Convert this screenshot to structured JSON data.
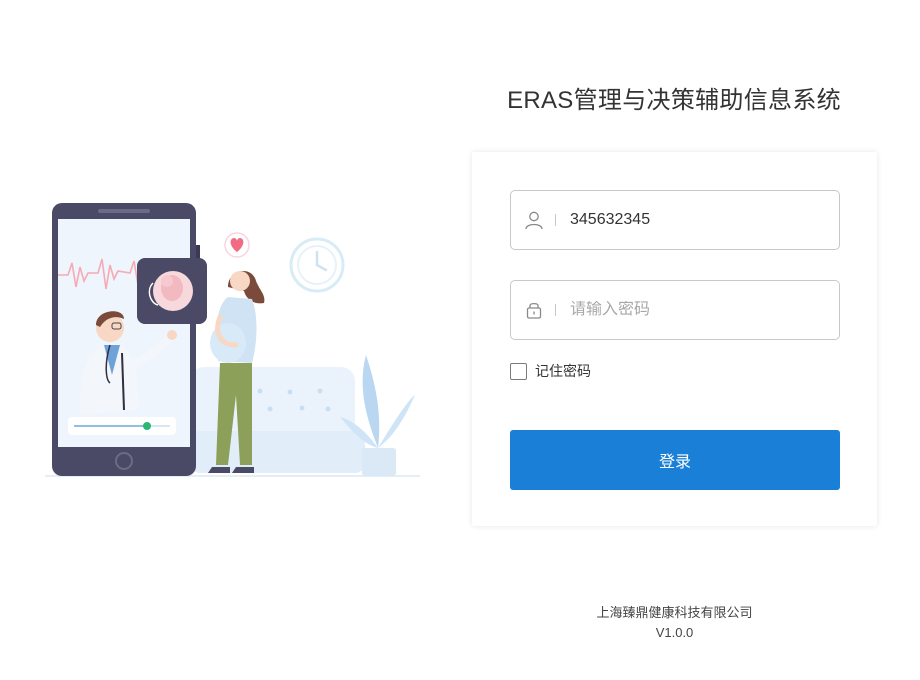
{
  "title": "ERAS管理与决策辅助信息系统",
  "login": {
    "username_value": "345632345",
    "password_placeholder": "请输入密码",
    "remember_label": "记住密码",
    "submit_label": "登录"
  },
  "footer": {
    "company": "上海臻鼎健康科技有限公司",
    "version": "V1.0.0"
  },
  "colors": {
    "primary": "#1a7fd6",
    "phone_frame": "#4a4a66",
    "heart": "#f06b83",
    "slider_dot": "#2bb673"
  },
  "icons": [
    "user-icon",
    "lock-icon",
    "heart-icon",
    "clock-icon"
  ]
}
